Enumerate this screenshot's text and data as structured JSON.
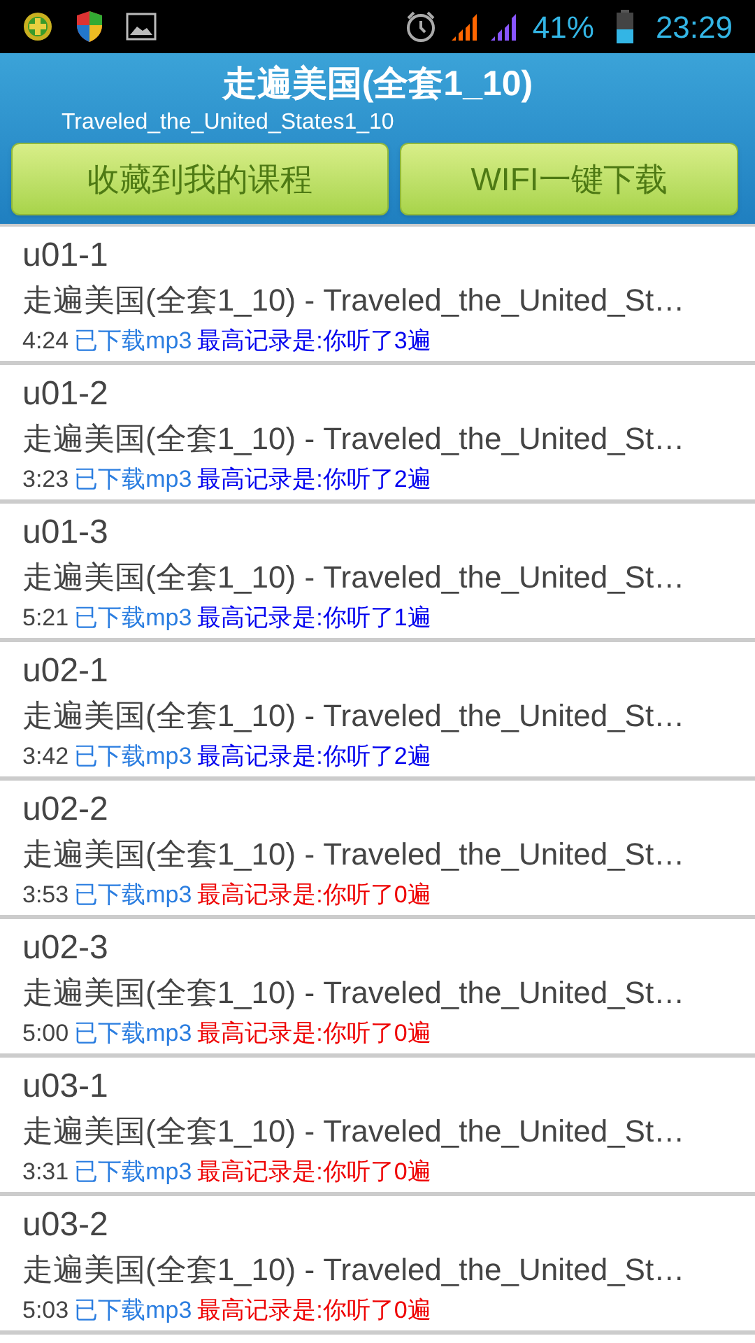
{
  "status_bar": {
    "battery": "41%",
    "time": "23:29"
  },
  "header": {
    "title": "走遍美国(全套1_10)",
    "subtitle": "Traveled_the_United_States1_10"
  },
  "buttons": [
    "收藏到我的课程",
    "WIFI一键下载"
  ],
  "lessons": [
    {
      "title": "u01-1",
      "subtitle": "走遍美国(全套1_10) - Traveled_the_United_St…",
      "duration": "4:24",
      "download": "已下载mp3",
      "record": "最高记录是:你听了3遍",
      "color": "#0000ee"
    },
    {
      "title": "u01-2",
      "subtitle": "走遍美国(全套1_10) - Traveled_the_United_St…",
      "duration": "3:23",
      "download": "已下载mp3",
      "record": "最高记录是:你听了2遍",
      "color": "#0000ee"
    },
    {
      "title": "u01-3",
      "subtitle": "走遍美国(全套1_10) - Traveled_the_United_St…",
      "duration": "5:21",
      "download": "已下载mp3",
      "record": "最高记录是:你听了1遍",
      "color": "#0000ee"
    },
    {
      "title": "u02-1",
      "subtitle": "走遍美国(全套1_10) - Traveled_the_United_St…",
      "duration": "3:42",
      "download": "已下载mp3",
      "record": "最高记录是:你听了2遍",
      "color": "#0000ee"
    },
    {
      "title": "u02-2",
      "subtitle": "走遍美国(全套1_10) - Traveled_the_United_St…",
      "duration": "3:53",
      "download": "已下载mp3",
      "record": "最高记录是:你听了0遍",
      "color": "#ee0000"
    },
    {
      "title": "u02-3",
      "subtitle": "走遍美国(全套1_10) - Traveled_the_United_St…",
      "duration": "5:00",
      "download": "已下载mp3",
      "record": "最高记录是:你听了0遍",
      "color": "#ee0000"
    },
    {
      "title": "u03-1",
      "subtitle": "走遍美国(全套1_10) - Traveled_the_United_St…",
      "duration": "3:31",
      "download": "已下载mp3",
      "record": "最高记录是:你听了0遍",
      "color": "#ee0000"
    },
    {
      "title": "u03-2",
      "subtitle": "走遍美国(全套1_10) - Traveled_the_United_St…",
      "duration": "5:03",
      "download": "已下载mp3",
      "record": "最高记录是:你听了0遍",
      "color": "#ee0000"
    }
  ]
}
